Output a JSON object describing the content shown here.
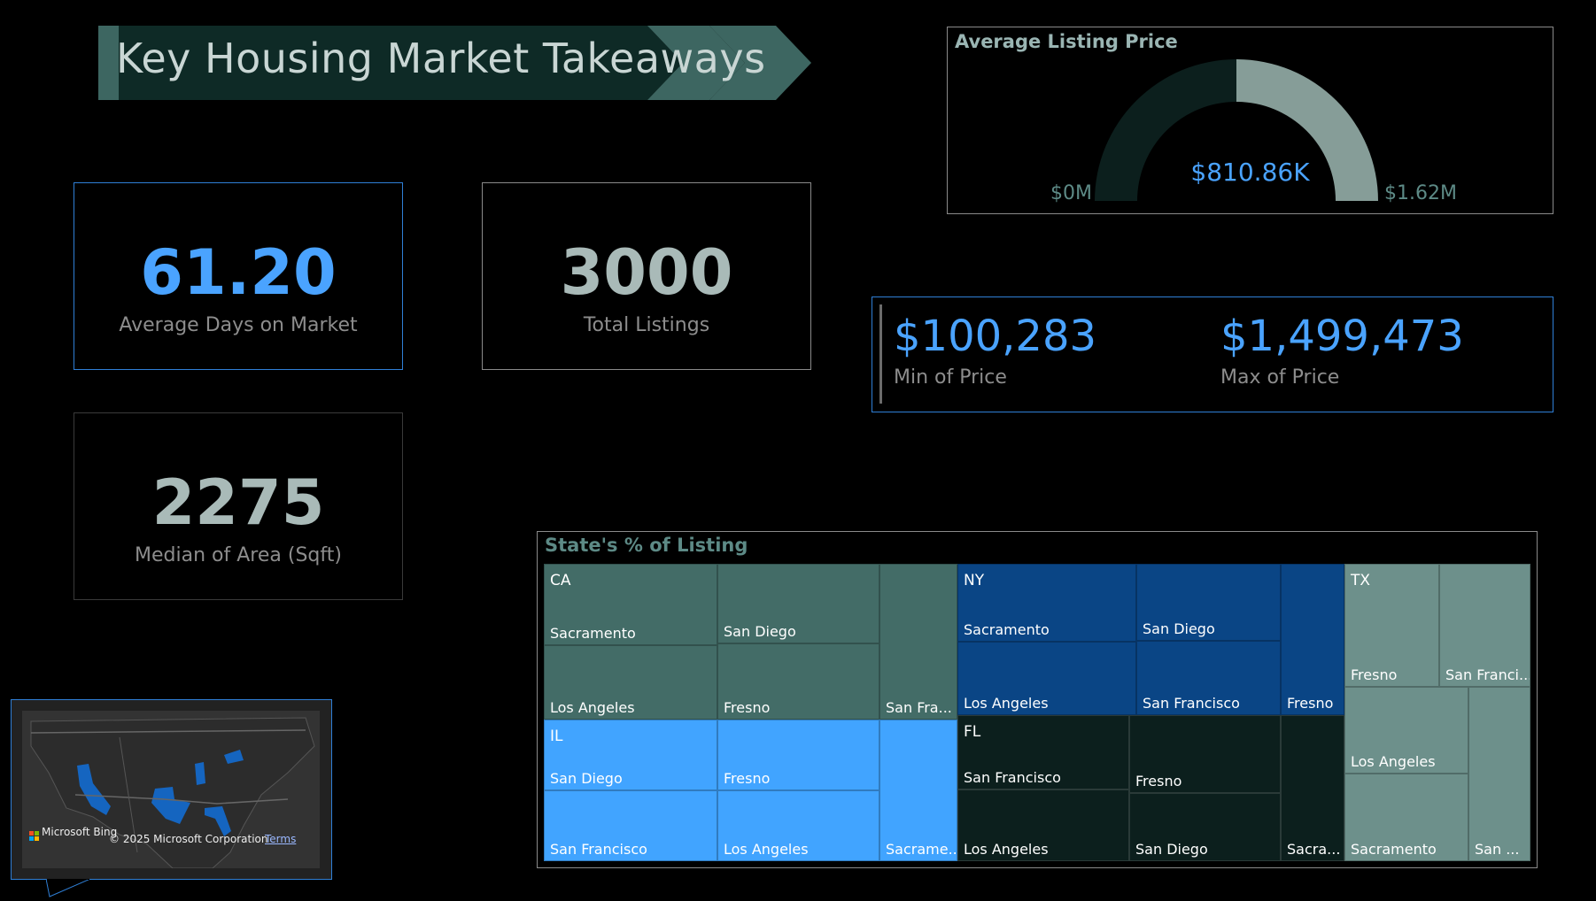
{
  "banner": {
    "title": "Key Housing Market Takeaways"
  },
  "kpis": {
    "avg_days": {
      "value": "61.20",
      "label": "Average Days on Market"
    },
    "total_listings": {
      "value": "3000",
      "label": "Total Listings"
    },
    "median_area": {
      "value": "2275",
      "label": "Median of Area (Sqft)"
    }
  },
  "gauge": {
    "title": "Average Listing Price",
    "value": "$810.86K",
    "min_label": "$0M",
    "max_label": "$1.62M",
    "fraction": 0.5,
    "fill_color": "#869d98",
    "track_color": "#0c1f1d"
  },
  "minmax": {
    "min_value": "$100,283",
    "min_label": "Min of Price",
    "max_value": "$1,499,473",
    "max_label": "Max of Price"
  },
  "treemap": {
    "title": "State's % of Listing",
    "states": {
      "CA": {
        "label": "CA",
        "color": "#436c67",
        "cities": [
          "Sacramento",
          "San Diego",
          "Los Angeles",
          "Fresno",
          "San Fra..."
        ]
      },
      "IL": {
        "label": "IL",
        "color": "#41a4ff",
        "cities": [
          "San Diego",
          "Fresno",
          "San Francisco",
          "Los Angeles",
          "Sacrame..."
        ]
      },
      "NY": {
        "label": "NY",
        "color": "#0a4585",
        "cities": [
          "Sacramento",
          "San Diego",
          "Los Angeles",
          "San Francisco",
          "Fresno"
        ]
      },
      "FL": {
        "label": "FL",
        "color": "#0c1f1d",
        "cities": [
          "San Francisco",
          "Fresno",
          "Los Angeles",
          "San Diego",
          "Sacra..."
        ]
      },
      "TX": {
        "label": "TX",
        "color": "#6d908b",
        "cities": [
          "Fresno",
          "San Franci...",
          "Los Angeles",
          "Sacramento",
          "San ..."
        ]
      }
    }
  },
  "map": {
    "credit": "Microsoft Bing",
    "copyright": "© 2025 Microsoft Corporation",
    "terms": "Terms",
    "highlight_color": "#1565c0"
  },
  "colors": {
    "accent_blue": "#4aa3ff",
    "kpi_gray": "#a9bab8"
  }
}
